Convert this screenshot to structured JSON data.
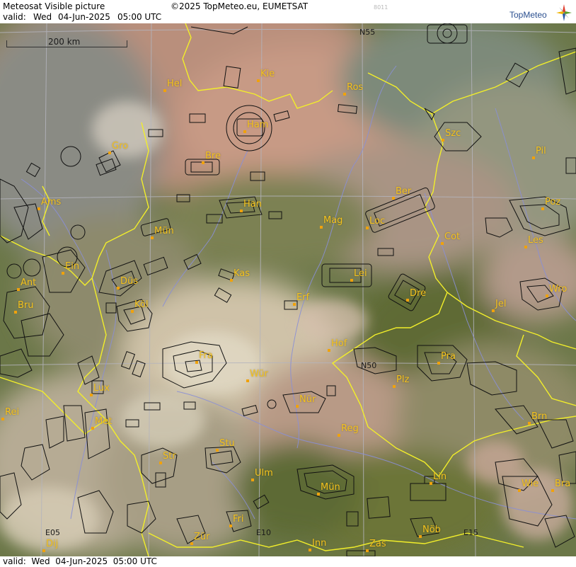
{
  "header": {
    "product_title": "Meteosat Visible picture",
    "copyright": "©2025 TopMeteo.eu, EUMETSAT",
    "image_code": "8011",
    "valid_label": "valid:",
    "valid_day": "Wed",
    "valid_date": "04-Jun-2025",
    "valid_time": "05:00 UTC",
    "logo_text": "TopMeteo",
    "logo_icon": "compass-star-icon"
  },
  "footer": {
    "valid_text": "valid:  Wed  04-Jun-2025  05:00 UTC"
  },
  "map": {
    "scale_bar_label": "200 km",
    "grid_labels": [
      {
        "id": "n55",
        "text": "N55"
      },
      {
        "id": "n50",
        "text": "N50"
      },
      {
        "id": "e05",
        "text": "E05"
      },
      {
        "id": "e10",
        "text": "E10"
      },
      {
        "id": "e15",
        "text": "E15"
      }
    ],
    "cities": [
      {
        "id": "hel",
        "label": "Hel"
      },
      {
        "id": "kie",
        "label": "Kie"
      },
      {
        "id": "ros",
        "label": "Ros"
      },
      {
        "id": "ham",
        "label": "Ham"
      },
      {
        "id": "szc",
        "label": "Szc"
      },
      {
        "id": "gro",
        "label": "Gro"
      },
      {
        "id": "bre-bremen",
        "label": "Bre"
      },
      {
        "id": "pil",
        "label": "Pil"
      },
      {
        "id": "ber",
        "label": "Ber"
      },
      {
        "id": "ams",
        "label": "Ams"
      },
      {
        "id": "han",
        "label": "Han"
      },
      {
        "id": "poz",
        "label": "Poz"
      },
      {
        "id": "mag",
        "label": "Mag"
      },
      {
        "id": "loc",
        "label": "Loc"
      },
      {
        "id": "mun",
        "label": "Mün"
      },
      {
        "id": "cot",
        "label": "Cot"
      },
      {
        "id": "les",
        "label": "Les"
      },
      {
        "id": "ein",
        "label": "Ein"
      },
      {
        "id": "kas",
        "label": "Kas"
      },
      {
        "id": "lei",
        "label": "Lei"
      },
      {
        "id": "ant",
        "label": "Ant"
      },
      {
        "id": "dus",
        "label": "Düs"
      },
      {
        "id": "wro",
        "label": "Wro"
      },
      {
        "id": "dre",
        "label": "Dre"
      },
      {
        "id": "bru",
        "label": "Bru"
      },
      {
        "id": "kol",
        "label": "Köl"
      },
      {
        "id": "erf",
        "label": "Erf"
      },
      {
        "id": "jel",
        "label": "Jel"
      },
      {
        "id": "hof",
        "label": "Hof"
      },
      {
        "id": "fra",
        "label": "Fra"
      },
      {
        "id": "pra",
        "label": "Pra"
      },
      {
        "id": "wur",
        "label": "Wür"
      },
      {
        "id": "plz",
        "label": "Plz"
      },
      {
        "id": "lux",
        "label": "Lux"
      },
      {
        "id": "nur",
        "label": "Nür"
      },
      {
        "id": "rei",
        "label": "Rei"
      },
      {
        "id": "met",
        "label": "Met"
      },
      {
        "id": "brn",
        "label": "Brn"
      },
      {
        "id": "reg",
        "label": "Reg"
      },
      {
        "id": "stu",
        "label": "Stu"
      },
      {
        "id": "str",
        "label": "Str"
      },
      {
        "id": "ulm",
        "label": "Ulm"
      },
      {
        "id": "lin",
        "label": "Lin"
      },
      {
        "id": "mun-munich",
        "label": "Mün"
      },
      {
        "id": "wie",
        "label": "Wie"
      },
      {
        "id": "bra",
        "label": "Bra"
      },
      {
        "id": "fri",
        "label": "Fri"
      },
      {
        "id": "dij",
        "label": "Dij"
      },
      {
        "id": "zur",
        "label": "Zür"
      },
      {
        "id": "nob",
        "label": "Nöb"
      },
      {
        "id": "inn",
        "label": "Inn"
      },
      {
        "id": "zas",
        "label": "Zas"
      }
    ],
    "colors": {
      "city_label": "#f4c21d",
      "border_line": "#f2ee2a",
      "river_line": "#8a8fd6",
      "airspace_line": "#111111",
      "grid_line": "#b4b4bd"
    }
  }
}
